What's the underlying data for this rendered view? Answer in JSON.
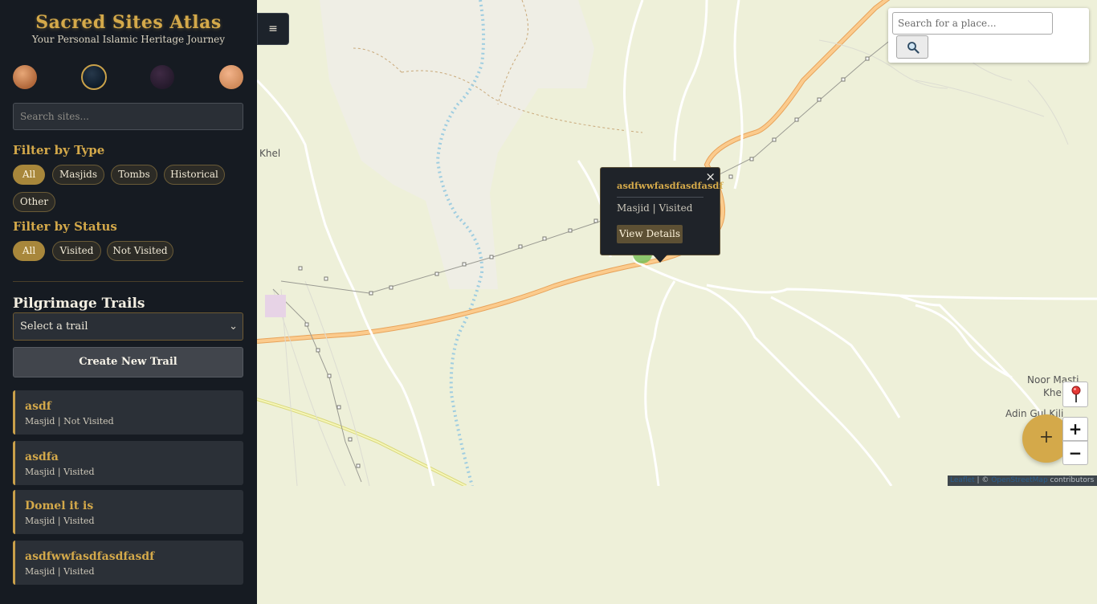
{
  "brand": {
    "title": "Sacred Sites Atlas",
    "subtitle": "Your Personal Islamic Heritage Journey"
  },
  "themes": [
    "copper-theme",
    "midnight-theme",
    "plum-theme",
    "peach-theme"
  ],
  "search": {
    "placeholder": "Search sites..."
  },
  "filters": {
    "type_label": "Filter by Type",
    "type_options": [
      "All",
      "Masjids",
      "Tombs",
      "Historical",
      "Other"
    ],
    "status_label": "Filter by Status",
    "status_options": [
      "All",
      "Visited",
      "Not Visited"
    ]
  },
  "trails": {
    "title": "Pilgrimage Trails",
    "select_value": "Select a trail",
    "create_label": "Create New Trail"
  },
  "sites": [
    {
      "name": "asdf",
      "meta": "Masjid | Not Visited"
    },
    {
      "name": "asdfa",
      "meta": "Masjid | Visited"
    },
    {
      "name": "Domel it is",
      "meta": "Masjid | Visited"
    },
    {
      "name": "asdfwwfasdfasdfasdf",
      "meta": "Masjid | Visited"
    }
  ],
  "map": {
    "menu_icon": "hamburger-icon",
    "place_search_placeholder": "Search for a place...",
    "labels": {
      "khel": "Khel",
      "noor_masti": "Noor Masti",
      "khel2": "Khel",
      "adin_gul": "Adin Gul Kili"
    },
    "popup": {
      "close": "×",
      "title": "asdfwwfasdfasdfasdf",
      "meta": "Masjid | Visited",
      "button": "View Details"
    },
    "zoom_in": "+",
    "zoom_out": "−",
    "fab": "+",
    "attribution": {
      "leaflet": "Leaflet",
      "sep": " | © ",
      "osm": "OpenStreetMap",
      "contrib": " contributors"
    }
  },
  "colors": {
    "accent": "#d4a94a",
    "sidebar_bg": "#161b22",
    "map_bg": "#eef0d9"
  }
}
